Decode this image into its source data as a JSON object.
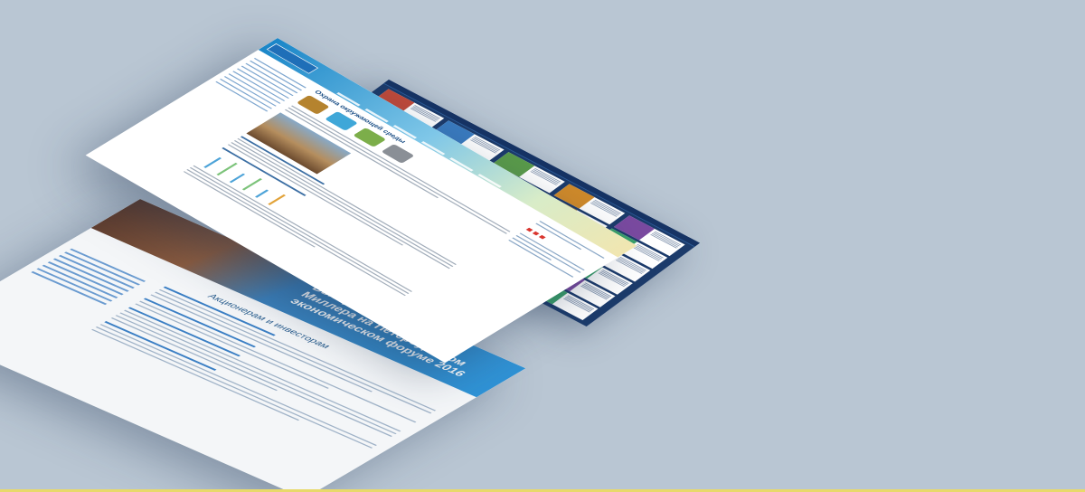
{
  "scene": {
    "background": "#b9c6d3",
    "accent_line": "#e8d96a"
  },
  "investors_page": {
    "banner_title": "Выступление Алексея Миллера на Петербургском экономическом форуме 2016",
    "section_title": "Акционерам и инвесторам",
    "colors": {
      "brand": "#2f93d6",
      "link": "#3b7fc4"
    }
  },
  "main_page": {
    "title": "Охрана окружающей среды",
    "colors": {
      "header_blue": "#1a86c8",
      "link": "#1c4f86",
      "badge_red": "#d9362f"
    }
  },
  "gallery_page": {
    "colors": {
      "background": "#1c3b6b"
    },
    "tile_colors": [
      "#c04a3a",
      "#3a7bbf",
      "#5a9b4a",
      "#d08a2a",
      "#7a4aa0",
      "#2a8a9a",
      "#b03060",
      "#4a6ab0",
      "#9a7a3a",
      "#3aa06a"
    ]
  }
}
